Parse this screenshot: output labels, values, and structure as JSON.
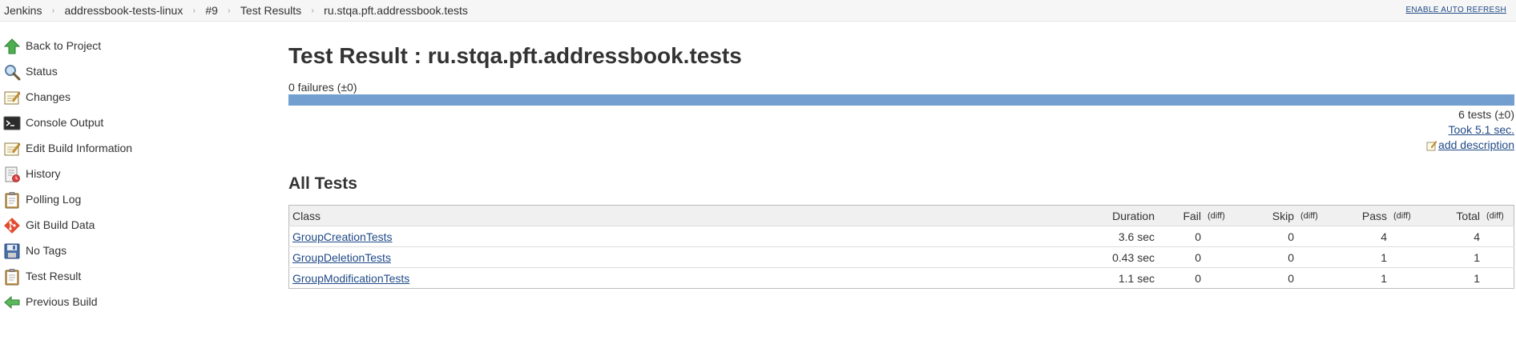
{
  "breadcrumbs": [
    "Jenkins",
    "addressbook-tests-linux",
    "#9",
    "Test Results",
    "ru.stqa.pft.addressbook.tests"
  ],
  "auto_refresh": "ENABLE AUTO REFRESH",
  "tasks": [
    {
      "label": "Back to Project",
      "icon": "up-arrow-icon"
    },
    {
      "label": "Status",
      "icon": "magnifier-icon"
    },
    {
      "label": "Changes",
      "icon": "notepad-icon"
    },
    {
      "label": "Console Output",
      "icon": "terminal-icon"
    },
    {
      "label": "Edit Build Information",
      "icon": "notepad-icon"
    },
    {
      "label": "History",
      "icon": "notepad-clock-icon"
    },
    {
      "label": "Polling Log",
      "icon": "clipboard-icon"
    },
    {
      "label": "Git Build Data",
      "icon": "git-icon"
    },
    {
      "label": "No Tags",
      "icon": "floppy-disk-icon"
    },
    {
      "label": "Test Result",
      "icon": "clipboard-icon"
    },
    {
      "label": "Previous Build",
      "icon": "left-arrow-icon"
    }
  ],
  "main": {
    "title": "Test Result : ru.stqa.pft.addressbook.tests",
    "failures": "0 failures (±0)",
    "pass_fraction": 1.0,
    "tests_count": "6 tests (±0)",
    "took": "Took 5.1 sec.",
    "add_description": "add description",
    "all_tests_title": "All Tests"
  },
  "table": {
    "headers": {
      "class": "Class",
      "duration": "Duration",
      "fail": "Fail",
      "skip": "Skip",
      "pass": "Pass",
      "total": "Total",
      "diff": "(diff)"
    },
    "rows": [
      {
        "class": "GroupCreationTests",
        "duration": "3.6 sec",
        "fail": "0",
        "skip": "0",
        "pass": "4",
        "total": "4"
      },
      {
        "class": "GroupDeletionTests",
        "duration": "0.43 sec",
        "fail": "0",
        "skip": "0",
        "pass": "1",
        "total": "1"
      },
      {
        "class": "GroupModificationTests",
        "duration": "1.1 sec",
        "fail": "0",
        "skip": "0",
        "pass": "1",
        "total": "1"
      }
    ]
  },
  "colors": {
    "pass_bar": "#729fcf",
    "link": "#204a87"
  }
}
